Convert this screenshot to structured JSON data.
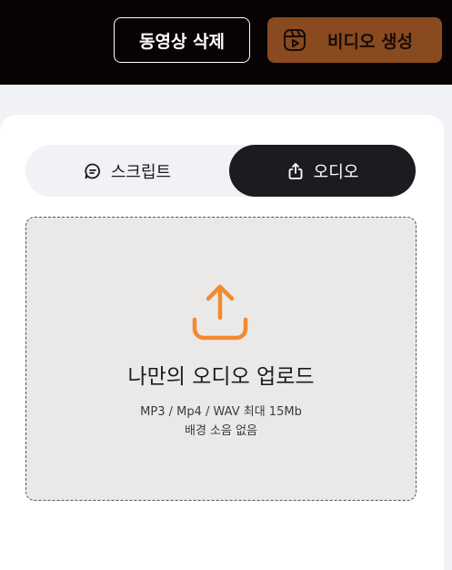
{
  "header": {
    "delete_label": "동영상 삭제",
    "generate_label": "비디오 생성",
    "generate_icon": "video-reel-icon"
  },
  "tabs": [
    {
      "label": "스크립트",
      "icon": "chat-bubble-icon",
      "active": false
    },
    {
      "label": "오디오",
      "icon": "share-upload-icon",
      "active": true
    }
  ],
  "dropzone": {
    "icon": "upload-icon",
    "title": "나만의 오디오 업로드",
    "formats": "MP3 / Mp4 / WAV 최대 15Mb",
    "note": "배경 소음 없음"
  },
  "colors": {
    "topbar": "#080302",
    "accent": "#f28a2e",
    "generate_bg": "#8a4a20",
    "active_tab": "#1b1c1f"
  }
}
